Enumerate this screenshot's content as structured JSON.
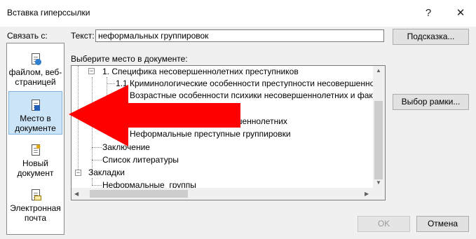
{
  "dialog": {
    "title": "Вставка гиперссылки",
    "help": "?",
    "close": "✕"
  },
  "link_with": "Связать с:",
  "places": [
    {
      "label": "файлом, веб-страницей",
      "icon": "file-web-icon"
    },
    {
      "label": "Место в документе",
      "icon": "place-in-document-icon",
      "selected": true
    },
    {
      "label": "Новый документ",
      "icon": "new-document-icon"
    },
    {
      "label": "Электронная почта",
      "icon": "email-icon"
    }
  ],
  "text_field": {
    "label": "Текст:",
    "value": "неформальных группировок"
  },
  "buttons": {
    "hint": "Подсказка...",
    "frame": "Выбор рамки...",
    "ok": "OK",
    "cancel": "Отмена"
  },
  "choose_label": "Выберите место в документе:",
  "tree": [
    {
      "text": "1. Специфика несовершеннолетних преступников"
    },
    {
      "text": "1.1 Криминологические особенности преступности несовершенно"
    },
    {
      "text": "1.2 Возрастные особенности психики несовершеннолетних и факт"
    },
    {
      "text": "2. Группы несовершеннолетних"
    },
    {
      "text": "2.1 Виды группировок несовершеннолетних"
    },
    {
      "text": "2.2 Неформальные преступные группировки"
    },
    {
      "text": "Заключение"
    },
    {
      "text": "Список литературы"
    },
    {
      "text": "Закладки"
    },
    {
      "text": "Неформальные_группы"
    }
  ],
  "colors": {
    "selected_place": "#cce4f7",
    "arrow": "#ff0000"
  }
}
